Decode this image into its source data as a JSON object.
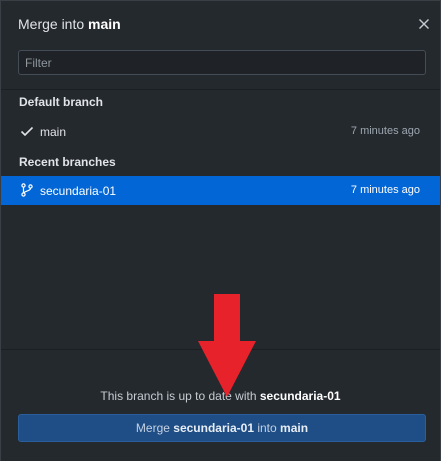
{
  "dialog": {
    "title_prefix": "Merge into",
    "title_branch": "main",
    "close_icon": "close-icon"
  },
  "filter": {
    "placeholder": "Filter",
    "value": ""
  },
  "default_section": {
    "heading": "Default branch",
    "branches": [
      {
        "name": "main",
        "time": "7 minutes ago",
        "icon": "check-icon",
        "selected": false
      }
    ]
  },
  "recent_section": {
    "heading": "Recent branches",
    "branches": [
      {
        "name": "secundaria-01",
        "time": "7 minutes ago",
        "icon": "git-branch-icon",
        "selected": true
      }
    ]
  },
  "footer": {
    "status_prefix": "This branch is up to date with",
    "status_branch": "secundaria-01",
    "merge_button": {
      "prefix": "Merge",
      "source": "secundaria-01",
      "middle": "into",
      "target": "main"
    }
  },
  "annotation": {
    "icon": "arrow-down-icon",
    "color": "#e8222b"
  },
  "colors": {
    "background": "#24292e",
    "selected_row": "#0366d6",
    "merge_button": "#1f4d85"
  }
}
